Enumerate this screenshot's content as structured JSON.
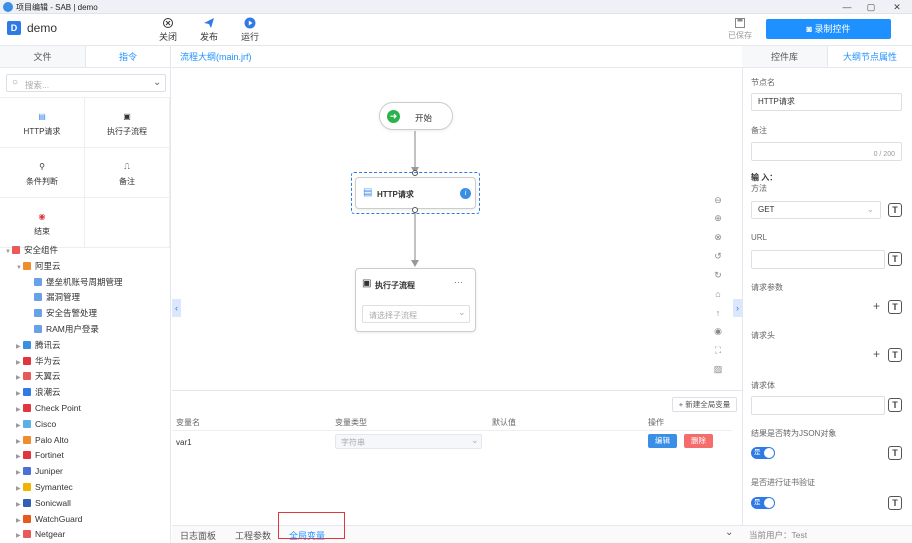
{
  "window": {
    "title": "项目编辑 - SAB | demo",
    "controls": [
      "—",
      "▢",
      "✕"
    ]
  },
  "toolbar": {
    "app_letter": "D",
    "app_name": "demo",
    "close_label": "关闭",
    "publish_label": "发布",
    "run_label": "运行",
    "saved_label": "已保存",
    "record_label": "录制控件"
  },
  "left": {
    "tabs": [
      "文件",
      "指令"
    ],
    "search_placeholder": "搜索...",
    "components": [
      "HTTP请求",
      "执行子流程",
      "条件判断",
      "备注",
      "结束"
    ],
    "tree": [
      {
        "label": "安全组件",
        "arrow": "▼",
        "indent": 0,
        "color": "#e85a5a"
      },
      {
        "label": "阿里云",
        "arrow": "▼",
        "indent": 1,
        "color": "#f08c2c"
      },
      {
        "label": "堡垒机账号周期管理",
        "arrow": "",
        "indent": 2,
        "color": "#6aa0e8"
      },
      {
        "label": "漏洞管理",
        "arrow": "",
        "indent": 2,
        "color": "#6aa0e8"
      },
      {
        "label": "安全告警处理",
        "arrow": "",
        "indent": 2,
        "color": "#6aa0e8"
      },
      {
        "label": "RAM用户登录",
        "arrow": "",
        "indent": 2,
        "color": "#6aa0e8"
      },
      {
        "label": "腾讯云",
        "arrow": "▶",
        "indent": 1,
        "color": "#3a8ee6"
      },
      {
        "label": "华为云",
        "arrow": "▶",
        "indent": 1,
        "color": "#e0373f"
      },
      {
        "label": "天翼云",
        "arrow": "▶",
        "indent": 1,
        "color": "#e85a5a"
      },
      {
        "label": "浪潮云",
        "arrow": "▶",
        "indent": 1,
        "color": "#2f7ae5"
      },
      {
        "label": "Check Point",
        "arrow": "▶",
        "indent": 1,
        "color": "#e0373f"
      },
      {
        "label": "Cisco",
        "arrow": "▶",
        "indent": 1,
        "color": "#5bb0e6"
      },
      {
        "label": "Palo Alto",
        "arrow": "▶",
        "indent": 1,
        "color": "#f08c2c"
      },
      {
        "label": "Fortinet",
        "arrow": "▶",
        "indent": 1,
        "color": "#e0373f"
      },
      {
        "label": "Juniper",
        "arrow": "▶",
        "indent": 1,
        "color": "#4a6fd8"
      },
      {
        "label": "Symantec",
        "arrow": "▶",
        "indent": 1,
        "color": "#f0b400"
      },
      {
        "label": "Sonicwall",
        "arrow": "▶",
        "indent": 1,
        "color": "#2f5fb8"
      },
      {
        "label": "WatchGuard",
        "arrow": "▶",
        "indent": 1,
        "color": "#e85a1a"
      },
      {
        "label": "Netgear",
        "arrow": "▶",
        "indent": 1,
        "color": "#e85a5a"
      }
    ]
  },
  "canvas": {
    "tab_label": "流程大纲(main.jrf)",
    "start_label": "开始",
    "http_label": "HTTP请求",
    "sub_label": "执行子流程",
    "sub_more": "···",
    "sub_placeholder": "请选择子流程"
  },
  "vars": {
    "new_label": "+ 新建全局变量",
    "headers": [
      "变量名",
      "变量类型",
      "默认值",
      "操作"
    ],
    "row": {
      "name": "var1",
      "type": "字符串",
      "default": "",
      "edit": "编辑",
      "delete": "删除"
    }
  },
  "bottom_tabs": [
    "日志面板",
    "工程参数",
    "全局变量"
  ],
  "right": {
    "tabs": [
      "控件库",
      "大纲节点属性"
    ],
    "node_name_label": "节点名",
    "node_name_value": "HTTP请求",
    "remark_label": "备注",
    "remark_counter": "0 / 200",
    "input_label": "输 入：",
    "method_label": "方法",
    "method_value": "GET",
    "url_label": "URL",
    "params_label": "请求参数",
    "headers_label": "请求头",
    "body_label": "请求体",
    "json_label": "结果是否转为JSON对象",
    "json_toggle": "是",
    "cert_label": "是否进行证书验证",
    "cert_toggle": "是",
    "current_user": "当前用户：Test"
  },
  "colors": {
    "accent": "#1e90ff",
    "danger": "#f56c6c",
    "start_green": "#2bb24c",
    "highlight_box": "#e0373f"
  }
}
